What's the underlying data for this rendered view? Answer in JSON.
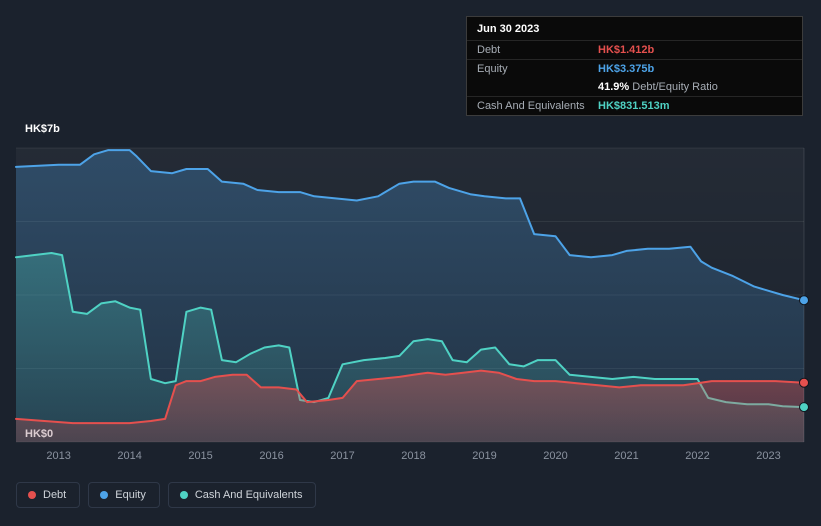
{
  "page": {
    "background": "#1b222d"
  },
  "tooltip": {
    "date": "Jun 30 2023",
    "debt_label": "Debt",
    "debt_value": "HK$1.412b",
    "debt_color": "#e5504e",
    "equity_label": "Equity",
    "equity_value": "HK$3.375b",
    "equity_color": "#4da3e8",
    "ratio_value": "41.9%",
    "ratio_label": " Debt/Equity Ratio",
    "cash_label": "Cash And Equivalents",
    "cash_value": "HK$831.513m",
    "cash_color": "#4fd2c4"
  },
  "axis": {
    "y_top": "HK$7b",
    "y_bottom": "HK$0",
    "x_ticks": [
      "2013",
      "2014",
      "2015",
      "2016",
      "2017",
      "2018",
      "2019",
      "2020",
      "2021",
      "2022",
      "2023"
    ]
  },
  "legend": [
    {
      "label": "Debt",
      "color": "#e5504e"
    },
    {
      "label": "Equity",
      "color": "#4da3e8"
    },
    {
      "label": "Cash And Equivalents",
      "color": "#4fd2c4"
    }
  ],
  "chart_data": {
    "type": "area",
    "title": "",
    "x_range": [
      2012.4,
      2023.5
    ],
    "y_range": [
      0,
      7
    ],
    "y_unit": "HK$ billions",
    "y_tick_labels": [
      "HK$0",
      "HK$7b"
    ],
    "gridlines_y": [
      0,
      1.75,
      3.5,
      5.25,
      7
    ],
    "legend_position": "bottom-left",
    "series": [
      {
        "name": "Equity",
        "color": "#4da3e8",
        "last_value_label": "HK$3.375b",
        "points": [
          [
            2012.4,
            6.55
          ],
          [
            2013.0,
            6.6
          ],
          [
            2013.3,
            6.6
          ],
          [
            2013.5,
            6.85
          ],
          [
            2013.7,
            6.95
          ],
          [
            2014.0,
            6.95
          ],
          [
            2014.1,
            6.8
          ],
          [
            2014.3,
            6.45
          ],
          [
            2014.6,
            6.4
          ],
          [
            2014.8,
            6.5
          ],
          [
            2015.1,
            6.5
          ],
          [
            2015.3,
            6.2
          ],
          [
            2015.6,
            6.15
          ],
          [
            2015.8,
            6.0
          ],
          [
            2016.1,
            5.95
          ],
          [
            2016.4,
            5.95
          ],
          [
            2016.6,
            5.85
          ],
          [
            2016.9,
            5.8
          ],
          [
            2017.2,
            5.75
          ],
          [
            2017.5,
            5.85
          ],
          [
            2017.8,
            6.15
          ],
          [
            2018.0,
            6.2
          ],
          [
            2018.3,
            6.2
          ],
          [
            2018.5,
            6.05
          ],
          [
            2018.8,
            5.9
          ],
          [
            2019.0,
            5.85
          ],
          [
            2019.3,
            5.8
          ],
          [
            2019.5,
            5.8
          ],
          [
            2019.7,
            4.95
          ],
          [
            2020.0,
            4.9
          ],
          [
            2020.2,
            4.45
          ],
          [
            2020.5,
            4.4
          ],
          [
            2020.8,
            4.45
          ],
          [
            2021.0,
            4.55
          ],
          [
            2021.3,
            4.6
          ],
          [
            2021.6,
            4.6
          ],
          [
            2021.9,
            4.65
          ],
          [
            2022.05,
            4.3
          ],
          [
            2022.2,
            4.15
          ],
          [
            2022.5,
            3.95
          ],
          [
            2022.8,
            3.7
          ],
          [
            2023.0,
            3.6
          ],
          [
            2023.2,
            3.5
          ],
          [
            2023.5,
            3.375
          ]
        ]
      },
      {
        "name": "Cash And Equivalents",
        "color": "#4fd2c4",
        "last_value_label": "HK$831.513m",
        "points": [
          [
            2012.4,
            4.4
          ],
          [
            2012.9,
            4.5
          ],
          [
            2013.05,
            4.45
          ],
          [
            2013.2,
            3.1
          ],
          [
            2013.4,
            3.05
          ],
          [
            2013.6,
            3.3
          ],
          [
            2013.8,
            3.35
          ],
          [
            2014.0,
            3.2
          ],
          [
            2014.15,
            3.15
          ],
          [
            2014.3,
            1.5
          ],
          [
            2014.5,
            1.4
          ],
          [
            2014.65,
            1.45
          ],
          [
            2014.8,
            3.1
          ],
          [
            2015.0,
            3.2
          ],
          [
            2015.15,
            3.15
          ],
          [
            2015.3,
            1.95
          ],
          [
            2015.5,
            1.9
          ],
          [
            2015.7,
            2.1
          ],
          [
            2015.9,
            2.25
          ],
          [
            2016.1,
            2.3
          ],
          [
            2016.25,
            2.25
          ],
          [
            2016.4,
            1.0
          ],
          [
            2016.6,
            0.95
          ],
          [
            2016.8,
            1.05
          ],
          [
            2017.0,
            1.85
          ],
          [
            2017.3,
            1.95
          ],
          [
            2017.6,
            2.0
          ],
          [
            2017.8,
            2.05
          ],
          [
            2018.0,
            2.4
          ],
          [
            2018.2,
            2.45
          ],
          [
            2018.4,
            2.4
          ],
          [
            2018.55,
            1.95
          ],
          [
            2018.75,
            1.9
          ],
          [
            2018.95,
            2.2
          ],
          [
            2019.15,
            2.25
          ],
          [
            2019.35,
            1.85
          ],
          [
            2019.55,
            1.8
          ],
          [
            2019.75,
            1.95
          ],
          [
            2020.0,
            1.95
          ],
          [
            2020.2,
            1.6
          ],
          [
            2020.5,
            1.55
          ],
          [
            2020.8,
            1.5
          ],
          [
            2021.1,
            1.55
          ],
          [
            2021.4,
            1.5
          ],
          [
            2021.7,
            1.5
          ],
          [
            2022.0,
            1.5
          ],
          [
            2022.15,
            1.05
          ],
          [
            2022.4,
            0.95
          ],
          [
            2022.7,
            0.9
          ],
          [
            2023.0,
            0.9
          ],
          [
            2023.2,
            0.85
          ],
          [
            2023.5,
            0.831
          ]
        ]
      },
      {
        "name": "Debt",
        "color": "#e5504e",
        "last_value_label": "HK$1.412b",
        "points": [
          [
            2012.4,
            0.55
          ],
          [
            2012.8,
            0.5
          ],
          [
            2013.2,
            0.45
          ],
          [
            2013.6,
            0.45
          ],
          [
            2014.0,
            0.45
          ],
          [
            2014.3,
            0.5
          ],
          [
            2014.5,
            0.55
          ],
          [
            2014.65,
            1.35
          ],
          [
            2014.8,
            1.45
          ],
          [
            2015.0,
            1.45
          ],
          [
            2015.2,
            1.55
          ],
          [
            2015.45,
            1.6
          ],
          [
            2015.65,
            1.6
          ],
          [
            2015.85,
            1.3
          ],
          [
            2016.1,
            1.3
          ],
          [
            2016.35,
            1.25
          ],
          [
            2016.5,
            0.95
          ],
          [
            2016.8,
            1.0
          ],
          [
            2017.0,
            1.05
          ],
          [
            2017.2,
            1.45
          ],
          [
            2017.5,
            1.5
          ],
          [
            2017.8,
            1.55
          ],
          [
            2018.0,
            1.6
          ],
          [
            2018.2,
            1.65
          ],
          [
            2018.45,
            1.6
          ],
          [
            2018.7,
            1.65
          ],
          [
            2018.95,
            1.7
          ],
          [
            2019.2,
            1.65
          ],
          [
            2019.45,
            1.5
          ],
          [
            2019.7,
            1.45
          ],
          [
            2020.0,
            1.45
          ],
          [
            2020.3,
            1.4
          ],
          [
            2020.6,
            1.35
          ],
          [
            2020.9,
            1.3
          ],
          [
            2021.2,
            1.35
          ],
          [
            2021.5,
            1.35
          ],
          [
            2021.8,
            1.35
          ],
          [
            2022.0,
            1.4
          ],
          [
            2022.2,
            1.45
          ],
          [
            2022.5,
            1.45
          ],
          [
            2022.8,
            1.45
          ],
          [
            2023.1,
            1.45
          ],
          [
            2023.5,
            1.412
          ]
        ]
      }
    ]
  }
}
